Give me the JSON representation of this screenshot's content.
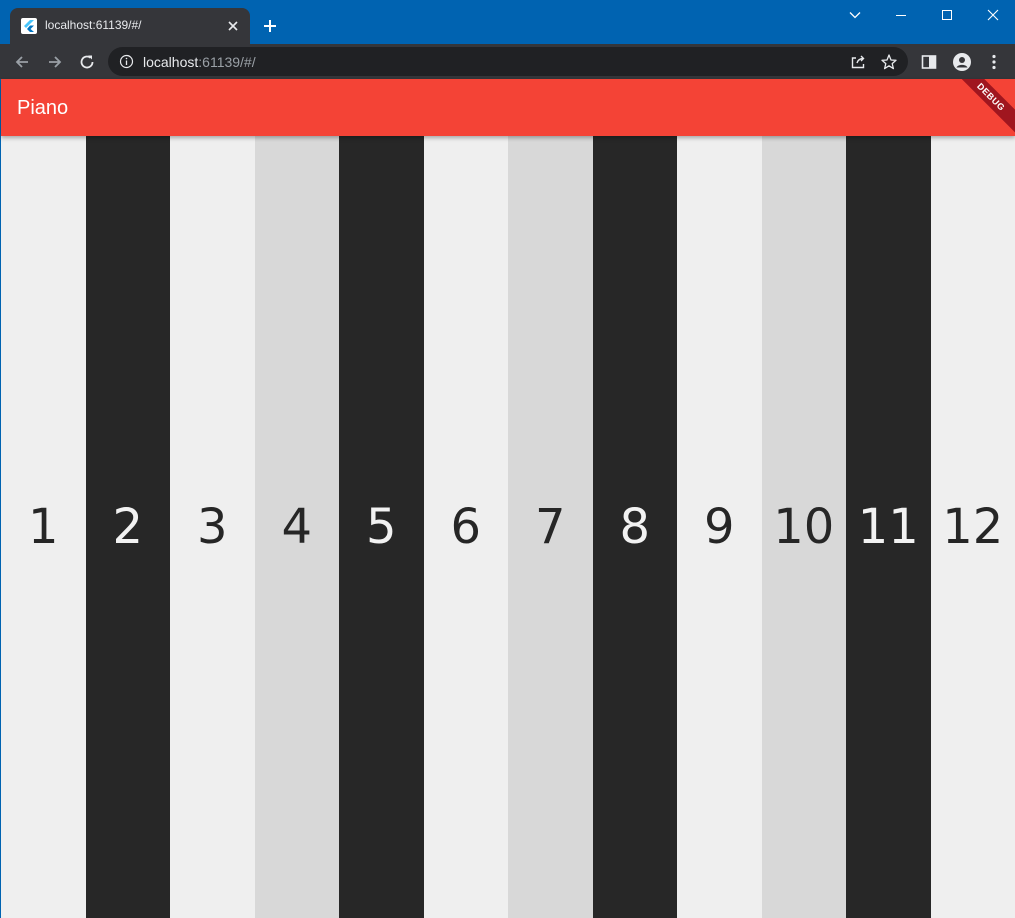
{
  "browser": {
    "tab_title": "localhost:61139/#/",
    "url_host": "localhost",
    "url_rest": ":61139/#/"
  },
  "app": {
    "title": "Piano",
    "debug_banner": "DEBUG",
    "accent_color": "#f44336"
  },
  "keys": [
    {
      "label": "1",
      "shade": "white"
    },
    {
      "label": "2",
      "shade": "black"
    },
    {
      "label": "3",
      "shade": "white"
    },
    {
      "label": "4",
      "shade": "gray"
    },
    {
      "label": "5",
      "shade": "black"
    },
    {
      "label": "6",
      "shade": "white"
    },
    {
      "label": "7",
      "shade": "gray"
    },
    {
      "label": "8",
      "shade": "black"
    },
    {
      "label": "9",
      "shade": "white"
    },
    {
      "label": "10",
      "shade": "gray"
    },
    {
      "label": "11",
      "shade": "black"
    },
    {
      "label": "12",
      "shade": "white"
    }
  ]
}
